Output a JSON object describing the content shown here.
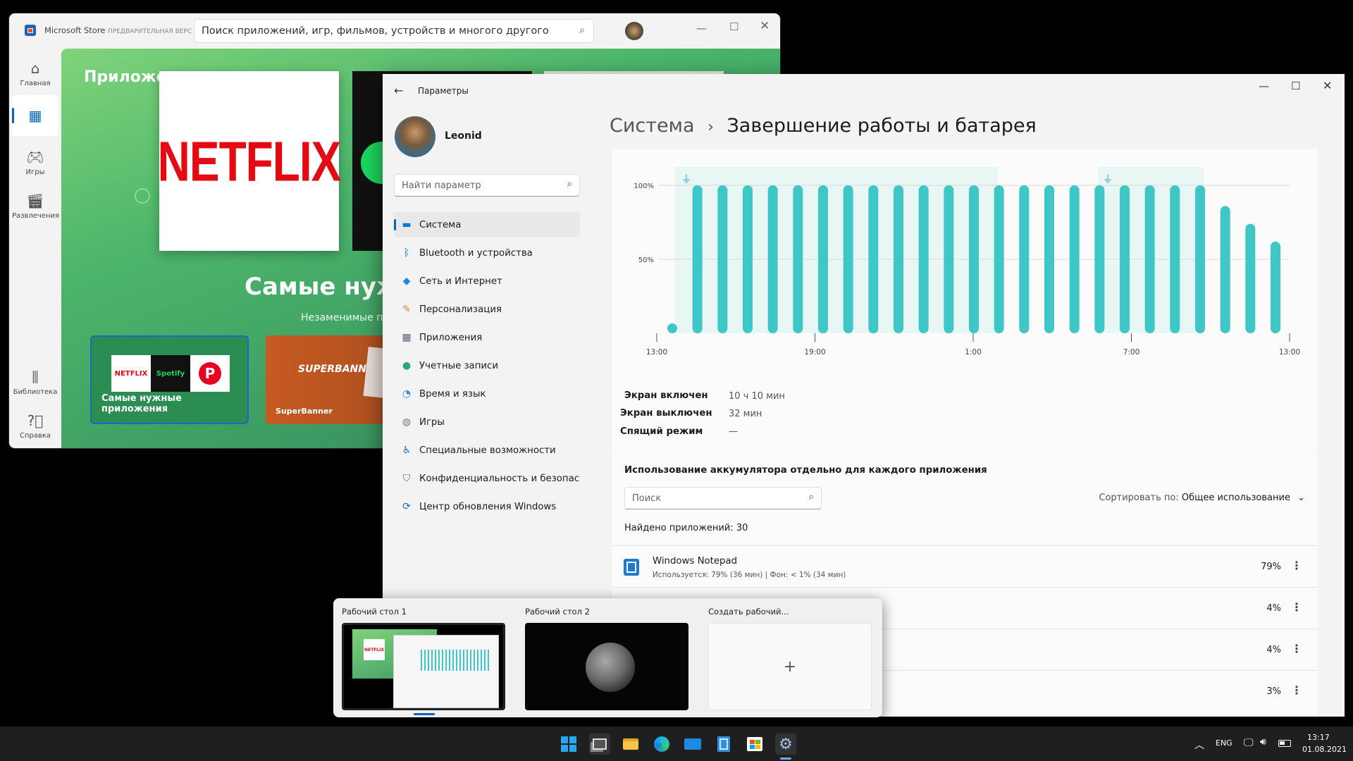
{
  "store": {
    "app_name": "Microsoft Store",
    "app_badge": "ПРЕДВАРИТЕЛЬНАЯ ВЕРС",
    "search_placeholder": "Поиск приложений, игр, фильмов, устройств и многого другого",
    "rail": [
      {
        "label": "Главная",
        "icon": "home-icon"
      },
      {
        "label": "",
        "icon": "apps-icon"
      },
      {
        "label": "Игры",
        "icon": "gamepad-icon"
      },
      {
        "label": "Развлечения",
        "icon": "movie-icon"
      },
      {
        "label": "Библиотека",
        "icon": "library-icon"
      },
      {
        "label": "Справка",
        "icon": "help-icon"
      }
    ],
    "hero_title": "Приложения",
    "netflix": "NETFLIX",
    "hero_heading": "Самые нуж",
    "hero_subtitle": "Незаменимые п",
    "tile1_logos": [
      "NETFLIX",
      "Spotify",
      "P"
    ],
    "tile1_label": "Самые нужные приложения",
    "tile2_logo": "SUPERBANNER",
    "tile2_label": "SuperBanner"
  },
  "settings": {
    "title": "Параметры",
    "user_name": "Leonid",
    "search_placeholder": "Найти параметр",
    "nav": [
      {
        "label": "Система",
        "icon": "monitor-icon",
        "color": "#0078d4"
      },
      {
        "label": "Bluetooth и устройства",
        "icon": "bluetooth-icon",
        "color": "#0067c0"
      },
      {
        "label": "Сеть и Интернет",
        "icon": "wifi-icon",
        "color": "#2a86d8"
      },
      {
        "label": "Персонализация",
        "icon": "brush-icon",
        "color": "#d68a2c"
      },
      {
        "label": "Приложения",
        "icon": "apps-icon",
        "color": "#5a6473"
      },
      {
        "label": "Учетные записи",
        "icon": "person-icon",
        "color": "#2aa876"
      },
      {
        "label": "Время и язык",
        "icon": "globe-clock-icon",
        "color": "#2a86d8"
      },
      {
        "label": "Игры",
        "icon": "gamepad-icon",
        "color": "#777"
      },
      {
        "label": "Специальные возможности",
        "icon": "accessibility-icon",
        "color": "#1b6fd1"
      },
      {
        "label": "Конфиденциальность и безопас",
        "icon": "shield-icon",
        "color": "#666"
      },
      {
        "label": "Центр обновления Windows",
        "icon": "update-icon",
        "color": "#1b6fd1"
      }
    ],
    "breadcrumb_parent": "Система",
    "breadcrumb_sep": "›",
    "breadcrumb_current": "Завершение работы и батарея",
    "stats": [
      {
        "label": "Экран включен",
        "value": "10 ч 10 мин"
      },
      {
        "label": "Экран выключен",
        "value": "32 мин"
      },
      {
        "label": "Спящий режим",
        "value": "—"
      }
    ],
    "usage_heading": "Использование аккумулятора отдельно для каждого приложения",
    "usage_search_placeholder": "Поиск",
    "sort_label": "Сортировать по:",
    "sort_value": "Общее использование",
    "found_label": "Найдено приложений: 30",
    "apps": [
      {
        "name": "Windows Notepad",
        "detail": "Используется: 79% (36 мин) | Фон: < 1% (34 мин)",
        "percent": "79%"
      },
      {
        "name": "",
        "detail": "",
        "percent": "4%"
      },
      {
        "name": "",
        "detail": "",
        "percent": "4%"
      },
      {
        "name": "",
        "detail": "",
        "percent": "3%"
      }
    ]
  },
  "chart_data": {
    "type": "bar",
    "ylim": [
      0,
      100
    ],
    "y_ticks": [
      "100%",
      "50%"
    ],
    "x_tick_labels": [
      "13:00",
      "19:00",
      "1:00",
      "7:00",
      "13:00"
    ],
    "charging_icon": "plug-icon",
    "values": [
      5,
      100,
      100,
      100,
      100,
      100,
      100,
      100,
      100,
      100,
      100,
      100,
      100,
      100,
      100,
      100,
      100,
      100,
      100,
      100,
      100,
      100,
      86,
      74,
      62
    ],
    "bar_color": "#3fc7c7",
    "charging_color": "#e8f6f4"
  },
  "taskview": {
    "desktops": [
      "Рабочий стол 1",
      "Рабочий стол 2",
      "Создать рабочий..."
    ],
    "add_symbol": "+"
  },
  "taskbar": {
    "lang": "ENG",
    "time": "13:17",
    "date": "01.08.2021"
  }
}
